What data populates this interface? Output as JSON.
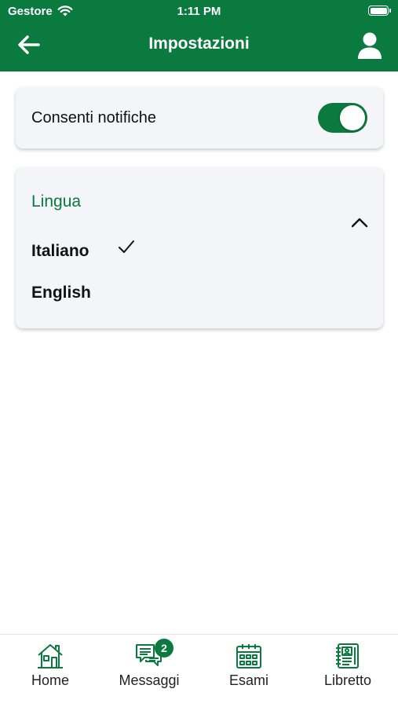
{
  "status_bar": {
    "carrier": "Gestore",
    "time": "1:11 PM"
  },
  "header": {
    "title": "Impostazioni",
    "back_icon": "arrow-left-icon",
    "profile_icon": "user-icon"
  },
  "notifications": {
    "label": "Consenti notifiche",
    "enabled": true
  },
  "language": {
    "header": "Lingua",
    "expanded": true,
    "options": [
      {
        "label": "Italiano",
        "selected": true
      },
      {
        "label": "English",
        "selected": false
      }
    ]
  },
  "tabbar": {
    "items": [
      {
        "label": "Home",
        "icon": "house-icon"
      },
      {
        "label": "Messaggi",
        "icon": "messages-icon",
        "badge": "2"
      },
      {
        "label": "Esami",
        "icon": "calendar-icon"
      },
      {
        "label": "Libretto",
        "icon": "notebook-icon"
      }
    ]
  },
  "colors": {
    "brand_green": "#0a7a3e",
    "card_background": "#f3f5f8"
  }
}
